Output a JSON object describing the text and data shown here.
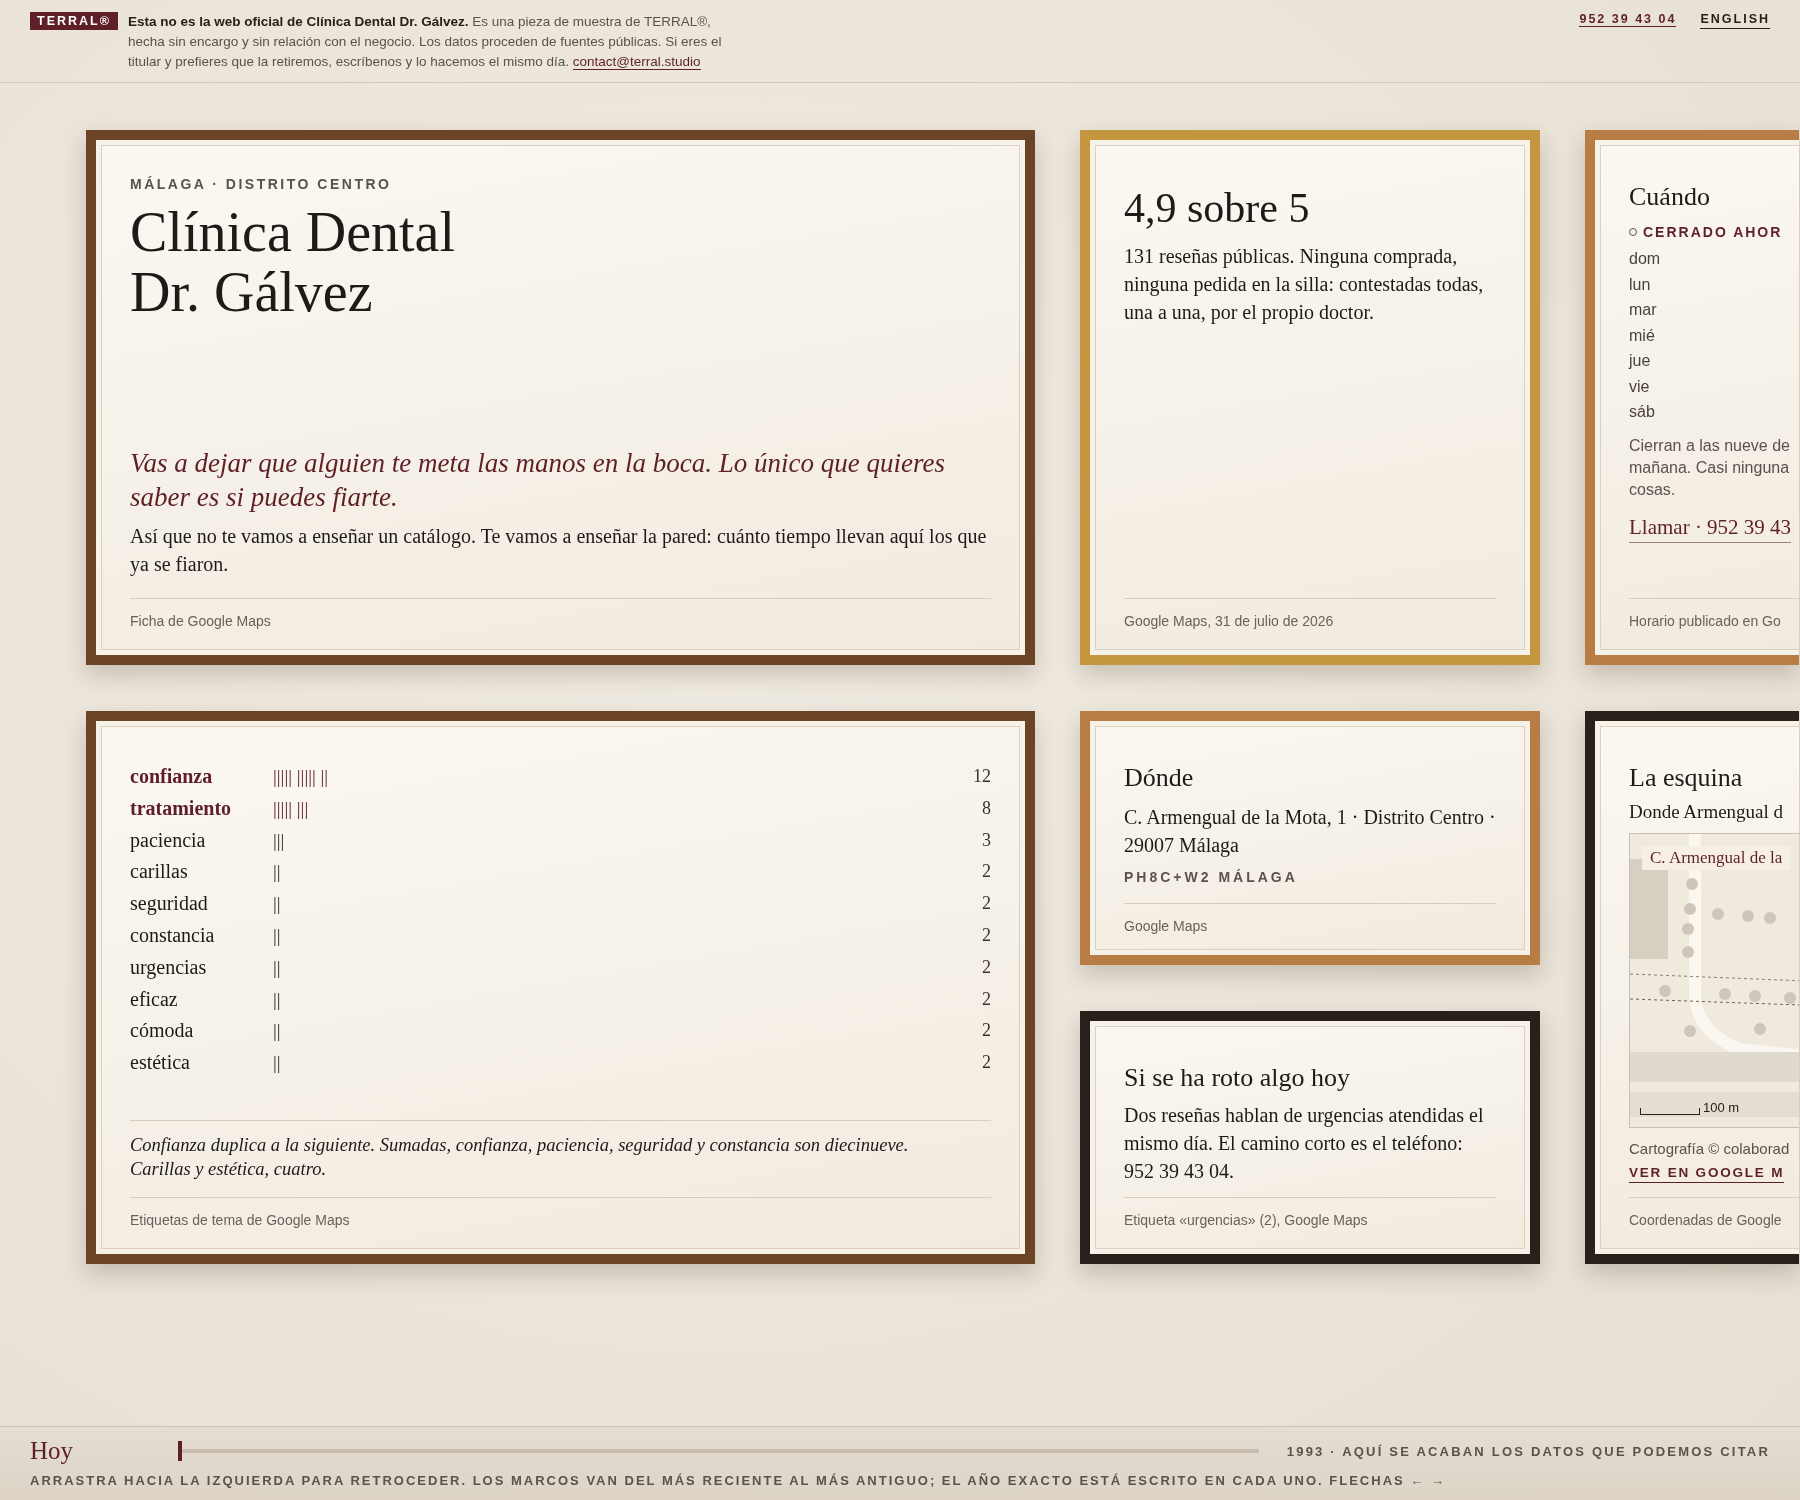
{
  "header": {
    "badge": "TERRAL®",
    "notice": "**Esta no es la web oficial de Clínica Dental Dr. Gálvez.** Es una pieza de muestra de TERRAL®, hecha sin encargo y sin relación con el negocio. Los datos proceden de fuentes públicas. Si eres el titular y prefieres que la retiremos, escríbenos y lo hacemos el mismo día.",
    "contact_link": "contact@terral.studio",
    "phone": "952 39 43 04",
    "language": "ENGLISH"
  },
  "cards": [
    {
      "kind": "intro",
      "color": "#6b4426",
      "kicker": "MÁLAGA · DISTRITO CENTRO",
      "title": "Clínica Dental Dr. Gálvez",
      "tagline": "Vas a dejar que alguien te meta las manos en la boca. Lo único que quieres saber es si puedes fiarte.",
      "body": "Así que no te vamos a enseñar un catálogo. Te vamos a enseñar la pared: cuánto tiempo llevan aquí los que ya se fiaron.",
      "source": "Ficha de Google Maps"
    },
    {
      "kind": "rating",
      "color": "#c4963f",
      "title": "4,9 sobre 5",
      "body": "131 reseñas públicas. Ninguna comprada, ninguna pedida en la silla: contestadas todas, una a una, por el propio doctor.",
      "source": "Google Maps, 31 de julio de 2026"
    },
    {
      "kind": "hours",
      "color": "#b87d45",
      "title": "Cuándo",
      "status": {
        "label": "CERRADO AHOR",
        "open": false
      },
      "days": [
        "dom",
        "lun",
        "mar",
        "mié",
        "jue",
        "vie",
        "sáb"
      ],
      "note_lines": [
        "Cierran a las nueve de",
        "mañana. Casi ninguna",
        "cosas."
      ],
      "call_link": "Llamar · 952 39 43",
      "source": "Horario publicado en Go"
    },
    {
      "kind": "tags",
      "color": "#6b4426",
      "tags": [
        {
          "name": "confianza",
          "tally": "||||| ||||| ||",
          "count": "12",
          "emphasized": true
        },
        {
          "name": "tratamiento",
          "tally": "||||| |||",
          "count": "8",
          "emphasized": true
        },
        {
          "name": "paciencia",
          "tally": "|||",
          "count": "3",
          "emphasized": false
        },
        {
          "name": "carillas",
          "tally": "||",
          "count": "2",
          "emphasized": false
        },
        {
          "name": "seguridad",
          "tally": "||",
          "count": "2",
          "emphasized": false
        },
        {
          "name": "constancia",
          "tally": "||",
          "count": "2",
          "emphasized": false
        },
        {
          "name": "urgencias",
          "tally": "||",
          "count": "2",
          "emphasized": false
        },
        {
          "name": "eficaz",
          "tally": "||",
          "count": "2",
          "emphasized": false
        },
        {
          "name": "cómoda",
          "tally": "||",
          "count": "2",
          "emphasized": false
        },
        {
          "name": "estética",
          "tally": "||",
          "count": "2",
          "emphasized": false
        }
      ],
      "note": "Confianza duplica a la siguiente. Sumadas, confianza, paciencia, seguridad y constancia son diecinueve. Carillas y estética, cuatro.",
      "source": "Etiquetas de tema de Google Maps"
    },
    {
      "kind": "address",
      "color": "#b87d45",
      "title": "Dónde",
      "address": "C. Armengual de la Mota, 1 · Distrito Centro · 29007 Málaga",
      "plus_code": "PH8C+W2 MÁLAGA",
      "source": "Google Maps"
    },
    {
      "kind": "urgent",
      "color": "#2a201b",
      "title": "Si se ha roto algo hoy",
      "body": "Dos reseñas hablan de urgencias atendidas el mismo día. El camino corto es el teléfono: 952 39 43 04.",
      "source": "Etiqueta «urgencias» (2), Google Maps"
    },
    {
      "kind": "map",
      "color": "#2a201b",
      "title": "La esquina",
      "subtitle": "Donde Armengual d",
      "map_label": "C. Armengual de la",
      "scale": "100 m",
      "credit": "Cartografía © colaborad",
      "link": "VER EN GOOGLE M",
      "source": "Coordenadas de Google"
    }
  ],
  "timeline": {
    "start_label": "Hoy",
    "level": 0,
    "end_label": "1993 · AQUÍ SE ACABAN LOS DATOS QUE PODEMOS CITAR",
    "hint": "ARRASTRA HACIA LA IZQUIERDA PARA RETROCEDER. LOS MARCOS VAN DEL MÁS RECIENTE AL MÁS ANTIGUO; EL AÑO EXACTO ESTÁ ESCRITO EN CADA UNO. FLECHAS ← →"
  }
}
